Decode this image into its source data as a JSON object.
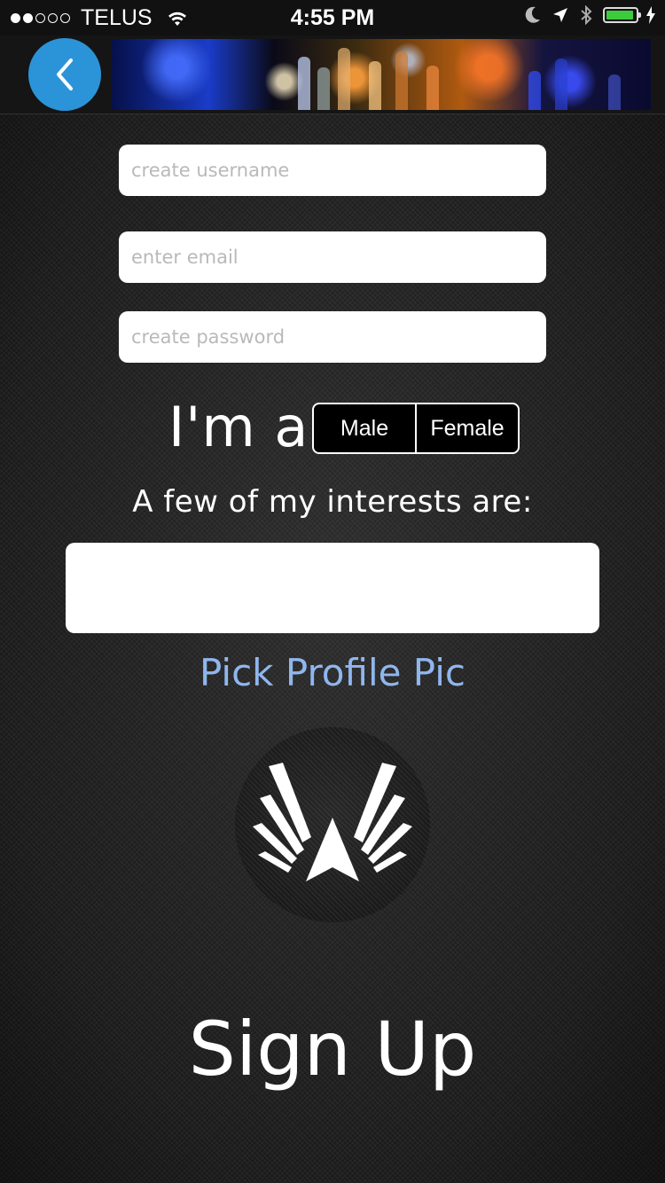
{
  "status_bar": {
    "carrier": "TELUS",
    "time": "4:55 PM",
    "signal_bars_filled": 2,
    "signal_bars_total": 5,
    "icons": [
      "wifi-icon",
      "moon-icon",
      "location-arrow-icon",
      "bluetooth-icon",
      "battery-icon",
      "charging-bolt-icon"
    ],
    "battery_color": "#3ccb3c"
  },
  "header": {
    "back_icon": "chevron-left-icon",
    "back_button_color": "#2b94d8"
  },
  "form": {
    "username_placeholder": "create username",
    "email_placeholder": "enter email",
    "password_placeholder": "create password",
    "gender_label": "I'm a:",
    "gender_options": [
      "Male",
      "Female"
    ],
    "interests_label": "A few of my interests are:",
    "interests_value": "",
    "pick_profile_pic": "Pick Profile Pic",
    "pick_profile_pic_color": "#8fb6ee",
    "logo_icon": "wings-logo-icon",
    "signup_label": "Sign Up"
  }
}
